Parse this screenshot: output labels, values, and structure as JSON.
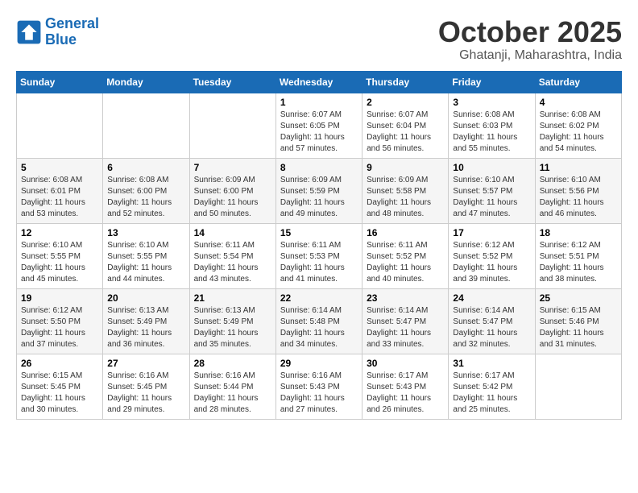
{
  "header": {
    "logo_line1": "General",
    "logo_line2": "Blue",
    "month": "October 2025",
    "location": "Ghatanji, Maharashtra, India"
  },
  "weekdays": [
    "Sunday",
    "Monday",
    "Tuesday",
    "Wednesday",
    "Thursday",
    "Friday",
    "Saturday"
  ],
  "weeks": [
    [
      {
        "day": "",
        "info": ""
      },
      {
        "day": "",
        "info": ""
      },
      {
        "day": "",
        "info": ""
      },
      {
        "day": "1",
        "info": "Sunrise: 6:07 AM\nSunset: 6:05 PM\nDaylight: 11 hours and 57 minutes."
      },
      {
        "day": "2",
        "info": "Sunrise: 6:07 AM\nSunset: 6:04 PM\nDaylight: 11 hours and 56 minutes."
      },
      {
        "day": "3",
        "info": "Sunrise: 6:08 AM\nSunset: 6:03 PM\nDaylight: 11 hours and 55 minutes."
      },
      {
        "day": "4",
        "info": "Sunrise: 6:08 AM\nSunset: 6:02 PM\nDaylight: 11 hours and 54 minutes."
      }
    ],
    [
      {
        "day": "5",
        "info": "Sunrise: 6:08 AM\nSunset: 6:01 PM\nDaylight: 11 hours and 53 minutes."
      },
      {
        "day": "6",
        "info": "Sunrise: 6:08 AM\nSunset: 6:00 PM\nDaylight: 11 hours and 52 minutes."
      },
      {
        "day": "7",
        "info": "Sunrise: 6:09 AM\nSunset: 6:00 PM\nDaylight: 11 hours and 50 minutes."
      },
      {
        "day": "8",
        "info": "Sunrise: 6:09 AM\nSunset: 5:59 PM\nDaylight: 11 hours and 49 minutes."
      },
      {
        "day": "9",
        "info": "Sunrise: 6:09 AM\nSunset: 5:58 PM\nDaylight: 11 hours and 48 minutes."
      },
      {
        "day": "10",
        "info": "Sunrise: 6:10 AM\nSunset: 5:57 PM\nDaylight: 11 hours and 47 minutes."
      },
      {
        "day": "11",
        "info": "Sunrise: 6:10 AM\nSunset: 5:56 PM\nDaylight: 11 hours and 46 minutes."
      }
    ],
    [
      {
        "day": "12",
        "info": "Sunrise: 6:10 AM\nSunset: 5:55 PM\nDaylight: 11 hours and 45 minutes."
      },
      {
        "day": "13",
        "info": "Sunrise: 6:10 AM\nSunset: 5:55 PM\nDaylight: 11 hours and 44 minutes."
      },
      {
        "day": "14",
        "info": "Sunrise: 6:11 AM\nSunset: 5:54 PM\nDaylight: 11 hours and 43 minutes."
      },
      {
        "day": "15",
        "info": "Sunrise: 6:11 AM\nSunset: 5:53 PM\nDaylight: 11 hours and 41 minutes."
      },
      {
        "day": "16",
        "info": "Sunrise: 6:11 AM\nSunset: 5:52 PM\nDaylight: 11 hours and 40 minutes."
      },
      {
        "day": "17",
        "info": "Sunrise: 6:12 AM\nSunset: 5:52 PM\nDaylight: 11 hours and 39 minutes."
      },
      {
        "day": "18",
        "info": "Sunrise: 6:12 AM\nSunset: 5:51 PM\nDaylight: 11 hours and 38 minutes."
      }
    ],
    [
      {
        "day": "19",
        "info": "Sunrise: 6:12 AM\nSunset: 5:50 PM\nDaylight: 11 hours and 37 minutes."
      },
      {
        "day": "20",
        "info": "Sunrise: 6:13 AM\nSunset: 5:49 PM\nDaylight: 11 hours and 36 minutes."
      },
      {
        "day": "21",
        "info": "Sunrise: 6:13 AM\nSunset: 5:49 PM\nDaylight: 11 hours and 35 minutes."
      },
      {
        "day": "22",
        "info": "Sunrise: 6:14 AM\nSunset: 5:48 PM\nDaylight: 11 hours and 34 minutes."
      },
      {
        "day": "23",
        "info": "Sunrise: 6:14 AM\nSunset: 5:47 PM\nDaylight: 11 hours and 33 minutes."
      },
      {
        "day": "24",
        "info": "Sunrise: 6:14 AM\nSunset: 5:47 PM\nDaylight: 11 hours and 32 minutes."
      },
      {
        "day": "25",
        "info": "Sunrise: 6:15 AM\nSunset: 5:46 PM\nDaylight: 11 hours and 31 minutes."
      }
    ],
    [
      {
        "day": "26",
        "info": "Sunrise: 6:15 AM\nSunset: 5:45 PM\nDaylight: 11 hours and 30 minutes."
      },
      {
        "day": "27",
        "info": "Sunrise: 6:16 AM\nSunset: 5:45 PM\nDaylight: 11 hours and 29 minutes."
      },
      {
        "day": "28",
        "info": "Sunrise: 6:16 AM\nSunset: 5:44 PM\nDaylight: 11 hours and 28 minutes."
      },
      {
        "day": "29",
        "info": "Sunrise: 6:16 AM\nSunset: 5:43 PM\nDaylight: 11 hours and 27 minutes."
      },
      {
        "day": "30",
        "info": "Sunrise: 6:17 AM\nSunset: 5:43 PM\nDaylight: 11 hours and 26 minutes."
      },
      {
        "day": "31",
        "info": "Sunrise: 6:17 AM\nSunset: 5:42 PM\nDaylight: 11 hours and 25 minutes."
      },
      {
        "day": "",
        "info": ""
      }
    ]
  ]
}
